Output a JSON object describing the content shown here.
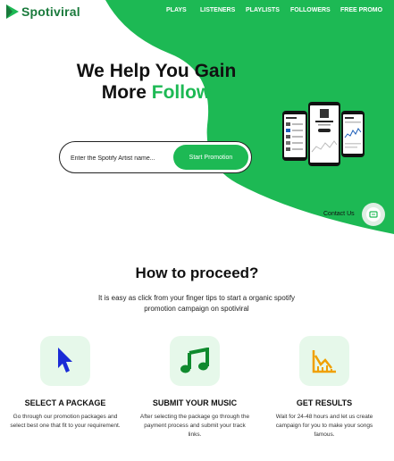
{
  "brand": {
    "name": "Spotiviral"
  },
  "nav": {
    "items": [
      "PLAYS",
      "LISTENERS",
      "PLAYLISTS",
      "FOLLOWERS",
      "FREE PROMO"
    ]
  },
  "hero": {
    "headline_part1": "We Help You Gain",
    "headline_part2": "More ",
    "headline_highlight": "Follow",
    "search_placeholder": "Enter the Spotify Artist name...",
    "cta_label": "Start Promotion"
  },
  "contact": {
    "label": "Contact Us"
  },
  "proceed": {
    "title": "How to proceed?",
    "description": "It is easy as click from your finger tips to start a organic spotify promotion campaign on spotiviral",
    "steps": [
      {
        "icon": "cursor-icon",
        "title": "SELECT A PACKAGE",
        "description": "Go through our promotion packages and select best one that fit to your requirement."
      },
      {
        "icon": "music-note-icon",
        "title": "SUBMIT YOUR MUSIC",
        "description": "After selecting the package go through the payment process and submit your track links."
      },
      {
        "icon": "chart-icon",
        "title": "GET RESULTS",
        "description": "Wait for 24-48 hours and let us create campaign for you to make your songs famous."
      }
    ]
  },
  "colors": {
    "accent": "#1db954",
    "accent_dark": "#1a7a3c",
    "icon_box": "#e6f8ea",
    "cursor": "#1a2bd6"
  }
}
